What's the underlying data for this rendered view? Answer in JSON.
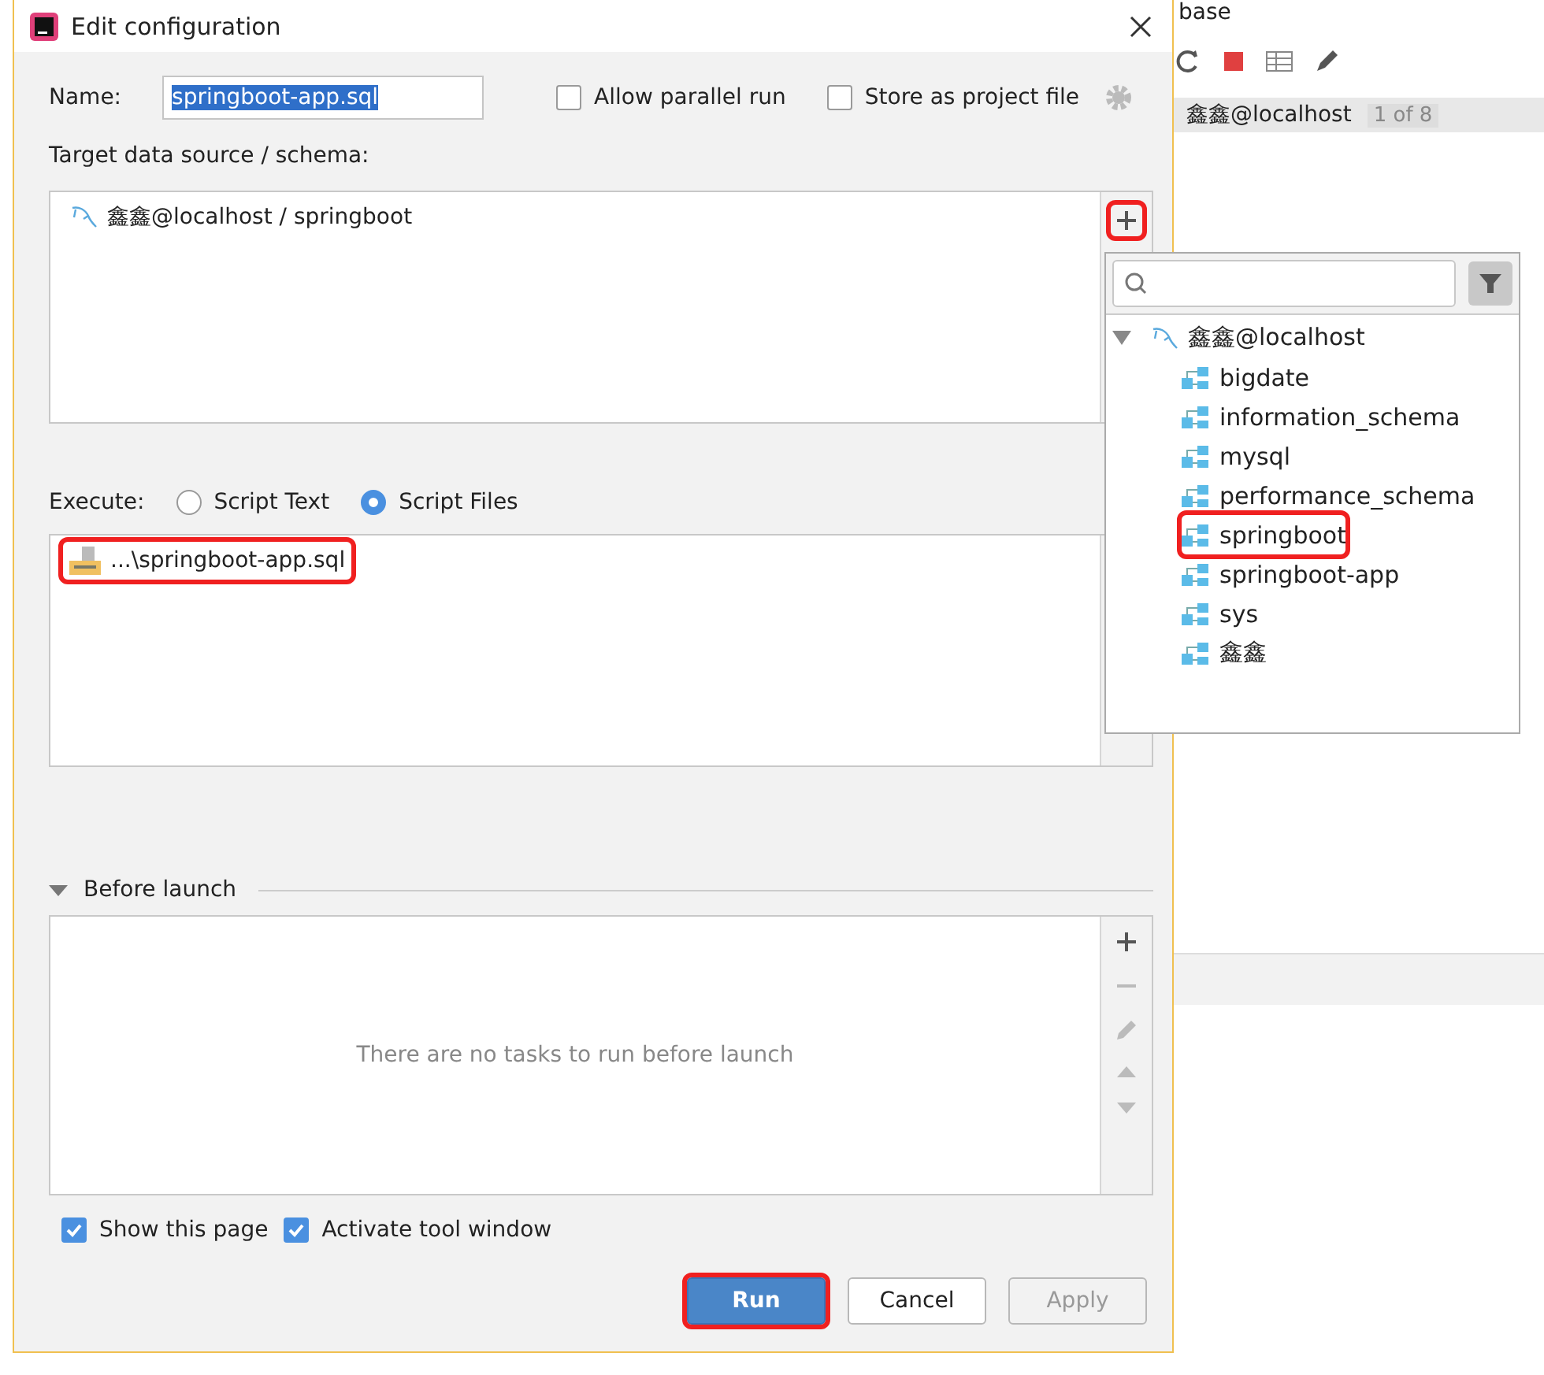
{
  "background_ide": {
    "header_text": "base",
    "connection": "鑫鑫@localhost",
    "page_count": "1 of 8"
  },
  "dialog": {
    "title": "Edit configuration",
    "name": {
      "label": "Name:",
      "value": "springboot-app.sql",
      "text_selected": true
    },
    "options": [
      {
        "label": "Allow parallel run",
        "checked": false
      },
      {
        "label": "Store as project file",
        "checked": false
      }
    ],
    "target": {
      "label": "Target data source / schema:",
      "items": [
        "鑫鑫@localhost / springboot"
      ],
      "add_highlighted": true
    },
    "execute": {
      "label": "Execute:",
      "options": [
        {
          "label": "Script Text",
          "selected": false
        },
        {
          "label": "Script Files",
          "selected": true
        }
      ]
    },
    "script_files": [
      {
        "path": "...\\springboot-app.sql",
        "highlighted": true
      }
    ],
    "before_launch": {
      "title": "Before launch",
      "expanded": true,
      "empty_text": "There are no tasks to run before launch"
    },
    "footer_checks": [
      {
        "label": "Show this page",
        "checked": true
      },
      {
        "label": "Activate tool window",
        "checked": true
      }
    ],
    "buttons": [
      {
        "label": "Run",
        "kind": "primary",
        "highlighted": true
      },
      {
        "label": "Cancel",
        "kind": "normal",
        "highlighted": false
      },
      {
        "label": "Apply",
        "kind": "disabled",
        "highlighted": false
      }
    ]
  },
  "schema_popup": {
    "tree": [
      {
        "label": "鑫鑫@localhost",
        "expanded": true,
        "children": [
          {
            "label": "bigdate",
            "highlighted": false
          },
          {
            "label": "information_schema",
            "highlighted": false
          },
          {
            "label": "mysql",
            "highlighted": false
          },
          {
            "label": "performance_schema",
            "highlighted": false
          },
          {
            "label": "springboot",
            "highlighted": true
          },
          {
            "label": "springboot-app",
            "highlighted": false
          },
          {
            "label": "sys",
            "highlighted": false
          },
          {
            "label": "鑫鑫",
            "highlighted": false
          }
        ]
      }
    ]
  }
}
